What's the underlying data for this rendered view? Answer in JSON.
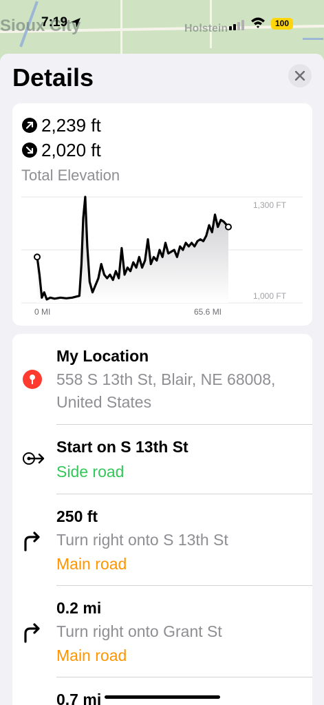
{
  "status_bar": {
    "time": "7:19",
    "battery": "100"
  },
  "map": {
    "labels": [
      "Sioux City",
      "Holstein"
    ]
  },
  "header": {
    "title": "Details",
    "close_icon": "close-icon"
  },
  "elevation": {
    "ascent": "2,239 ft",
    "descent": "2,020 ft",
    "label": "Total Elevation",
    "y_top_label": "1,300 FT",
    "y_bottom_label": "1,000 FT",
    "x_start_label": "0 MI",
    "x_end_label": "65.6 MI"
  },
  "chart_data": {
    "type": "area",
    "ylim": [
      1000,
      1300
    ],
    "x": [
      0,
      0.8,
      1.6,
      2.4,
      3.3,
      4.5,
      6,
      8,
      10,
      12,
      14.5,
      15.2,
      15.8,
      16.5,
      17.2,
      18,
      19,
      20,
      21,
      22,
      23,
      24,
      25,
      26,
      27,
      28,
      29,
      30,
      31,
      32,
      33,
      34,
      35,
      36,
      37,
      38,
      39,
      40,
      41,
      42,
      43,
      44,
      45,
      46,
      47,
      48,
      49,
      50,
      51,
      52,
      53,
      54,
      55,
      56,
      57,
      58,
      59,
      60,
      61,
      62,
      63,
      64,
      65.6
    ],
    "values": [
      1130,
      1080,
      1015,
      1030,
      1010,
      1015,
      1012,
      1015,
      1013,
      1015,
      1020,
      1110,
      1240,
      1300,
      1160,
      1060,
      1030,
      1050,
      1070,
      1110,
      1080,
      1070,
      1080,
      1065,
      1090,
      1070,
      1155,
      1080,
      1100,
      1090,
      1115,
      1100,
      1130,
      1100,
      1120,
      1180,
      1110,
      1130,
      1120,
      1150,
      1130,
      1170,
      1140,
      1145,
      1150,
      1130,
      1160,
      1150,
      1170,
      1160,
      1170,
      1160,
      1175,
      1180,
      1175,
      1190,
      1220,
      1200,
      1250,
      1215,
      1235,
      1230,
      1215
    ]
  },
  "directions": [
    {
      "icon": "location-pin-icon",
      "primary": "My Location",
      "secondary": "558 S 13th St, Blair, NE  68008,",
      "secondary2": "United States",
      "tertiary": ""
    },
    {
      "icon": "start-arrow-icon",
      "primary": "Start on S 13th St",
      "secondary": "",
      "tertiary": "Side road",
      "tertiary_color": "#34c759"
    },
    {
      "icon": "turn-right-icon",
      "primary": "250 ft",
      "secondary": "Turn right onto S 13th St",
      "tertiary": "Main road",
      "tertiary_color": "#ff9500"
    },
    {
      "icon": "turn-right-icon",
      "primary": "0.2 mi",
      "secondary": "Turn right onto Grant St",
      "tertiary": "Main road",
      "tertiary_color": "#ff9500"
    },
    {
      "icon": "",
      "primary": "0.7 mi",
      "secondary": "",
      "tertiary": ""
    }
  ],
  "colors": {
    "accent_green": "#34c759",
    "accent_orange": "#ff9500",
    "pin_red": "#ff3b30",
    "battery": "#ffd60a"
  }
}
